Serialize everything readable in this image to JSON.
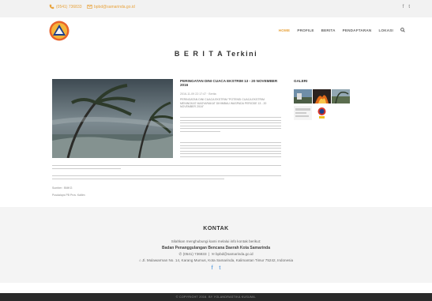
{
  "topbar": {
    "phone": "(0541) 736833",
    "email": "bpbd@samarinda.go.id",
    "social": {
      "facebook": "f",
      "twitter": "t"
    }
  },
  "nav": {
    "items": [
      {
        "label": "HOME",
        "active": true
      },
      {
        "label": "PROFILE",
        "active": false
      },
      {
        "label": "BERITA",
        "active": false
      },
      {
        "label": "PENDAFTARAN",
        "active": false
      },
      {
        "label": "LOKASI",
        "active": false
      }
    ],
    "search_icon": "search-icon"
  },
  "page": {
    "title": "B E R I T A Terkini"
  },
  "article": {
    "title": "PERINGATAN DINI CUACA EKSTRIM 13 - 20 NOVEMBER 2016",
    "meta": "2016-11-09 22:17:47 · Berita",
    "lead": "PERINGATAN DINI CUACA EKSTRIM \"POTENSI CUACA EKSTRIM MENINGKAT MASYARAKAT DIHIMBAU WASPADA PERIODE 13 - 20 NOVEMBER 2016\"",
    "source": "Sumber : BMKG",
    "publisher": "Pusdalops PB Prov. Kaltim"
  },
  "gallery": {
    "title": "GALERI"
  },
  "kontak": {
    "title": "KONTAK",
    "subtitle": "Silahkan menghubungi kami melalui info kontak berikut:",
    "org": "Badan Penanggulangan Bencana Daerah Kota Samarinda",
    "phone": "(0541) 736833",
    "email": "bpbd@samarinda.go.id",
    "address": "Jl. Mulawarman No. 14, Karang Mumus, Kota Samarinda, Kalimantan Timur 75242, Indonesia"
  },
  "footer": {
    "copyright": "© COPYRIGHT 2016. BY YOLANDRASTIKA KUSUMA."
  },
  "colors": {
    "accent": "#e8a33c",
    "social": "#3b8ad9",
    "footer_bg": "#2a2a2a"
  }
}
